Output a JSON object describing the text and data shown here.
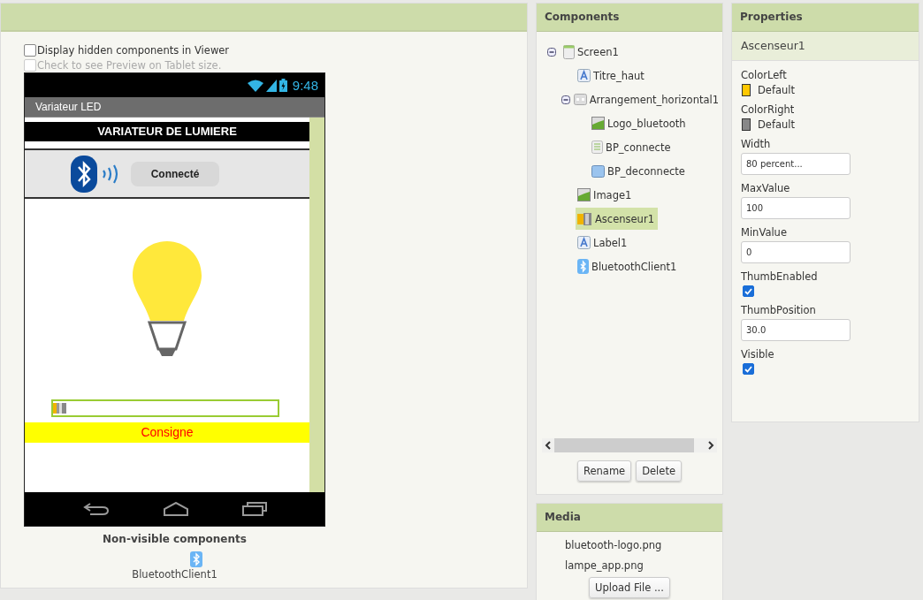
{
  "viewer": {
    "options": [
      {
        "label": "Display hidden components in Viewer",
        "checked": false,
        "disabled": false
      },
      {
        "label": "Check to see Preview on Tablet size.",
        "checked": false,
        "disabled": true
      }
    ],
    "phone": {
      "time": "9:48",
      "app_title": "Variateur LED",
      "title_label": "VARIATEUR DE LUMIERE",
      "connect_button": "Connecté",
      "slider": {
        "level": 0
      },
      "consigne_label": "Consigne"
    },
    "nonvisible_title": "Non-visible components",
    "nonvisible_items": [
      "BluetoothClient1"
    ]
  },
  "components": {
    "title": "Components",
    "tree": [
      {
        "name": "Screen1",
        "kind": "screen",
        "expanded": true,
        "selected": false,
        "children": [
          {
            "name": "Titre_haut",
            "kind": "label",
            "selected": false
          },
          {
            "name": "Arrangement_horizontal1",
            "kind": "arrangement",
            "expanded": true,
            "selected": false,
            "children": [
              {
                "name": "Logo_bluetooth",
                "kind": "image",
                "selected": false
              },
              {
                "name": "BP_connecte",
                "kind": "listpicker",
                "selected": false
              },
              {
                "name": "BP_deconnecte",
                "kind": "button",
                "selected": false
              }
            ]
          },
          {
            "name": "Image1",
            "kind": "image",
            "selected": false
          },
          {
            "name": "Ascenseur1",
            "kind": "slider",
            "selected": true
          },
          {
            "name": "Label1",
            "kind": "label",
            "selected": false
          },
          {
            "name": "BluetoothClient1",
            "kind": "bluetooth",
            "selected": false
          }
        ]
      }
    ],
    "buttons": [
      "Rename",
      "Delete"
    ]
  },
  "media": {
    "title": "Media",
    "files": [
      "bluetooth-logo.png",
      "lampe_app.png"
    ],
    "upload_button": "Upload File ..."
  },
  "properties": {
    "title": "Properties",
    "component": "Ascenseur1",
    "items": [
      {
        "kind": "color",
        "label": "ColorLeft",
        "value": "Default",
        "color": "#ffc800"
      },
      {
        "kind": "color",
        "label": "ColorRight",
        "value": "Default",
        "color": "#888888"
      },
      {
        "kind": "text",
        "label": "Width",
        "value": "80 percent..."
      },
      {
        "kind": "text",
        "label": "MaxValue",
        "value": "100"
      },
      {
        "kind": "text",
        "label": "MinValue",
        "value": "0"
      },
      {
        "kind": "checkbox",
        "label": "ThumbEnabled",
        "checked": true
      },
      {
        "kind": "text",
        "label": "ThumbPosition",
        "value": "30.0"
      },
      {
        "kind": "checkbox",
        "label": "Visible",
        "checked": true
      }
    ]
  }
}
